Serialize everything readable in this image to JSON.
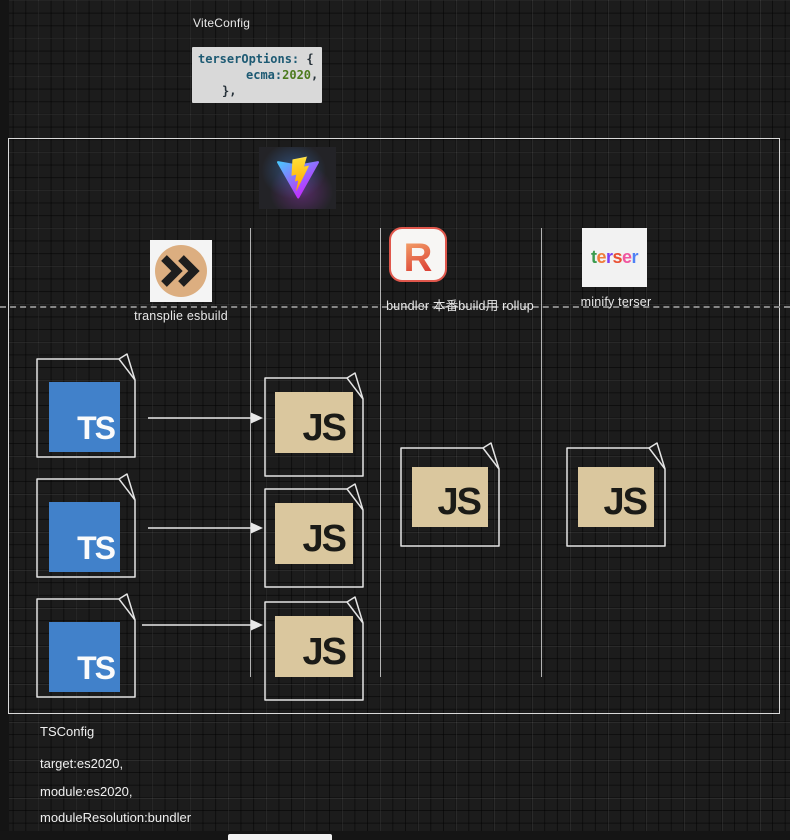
{
  "header": {
    "vite_config_label": "ViteConfig",
    "code": {
      "l1_key": "terserOptions:",
      "l1_punct": " {",
      "l2_key": "ecma:",
      "l2_value": "2020",
      "l2_punct": ",",
      "l3_punct": "},",
      "bg_color": "#d9d9d9",
      "key_color": "#1d5a73",
      "value_color": "#4c7a1d",
      "punct_color": "#27323a"
    }
  },
  "diagram": {
    "vite_icon": {
      "name": "vite-logo",
      "v_from": "#41D1FF",
      "v_to": "#BD34FE",
      "bolt_from": "#FFEA83",
      "bolt_mid": "#FFDD35",
      "bolt_to": "#FFA800"
    },
    "stages": {
      "esbuild": {
        "label": "transplie esbuild",
        "circle_color": "#dcae80",
        "chevron_color": "#1e1e1e"
      },
      "rollup": {
        "label": "bundler 本番build用 rollup",
        "letter": "R",
        "border_color": "#e0574c",
        "gradient_from": "#f7b071",
        "gradient_to": "#da3b32"
      },
      "terser": {
        "label": "minify terser",
        "letters": [
          {
            "ch": "t",
            "color": "#3b9b4e"
          },
          {
            "ch": "e",
            "color": "#f07c3a"
          },
          {
            "ch": "r",
            "color": "#7b3ff2"
          },
          {
            "ch": "s",
            "color": "#ea4f33"
          },
          {
            "ch": "e",
            "color": "#f0569f"
          },
          {
            "ch": "r",
            "color": "#4f81f5"
          }
        ]
      }
    },
    "files": {
      "ts_label": "TS",
      "ts_bg": "#4181ca",
      "ts_text": "#fbfbfb",
      "js_label": "JS",
      "js_bg": "#dac79e",
      "js_text": "#1b1b17"
    }
  },
  "footer": {
    "title": "TSConfig",
    "lines": [
      "target:es2020,",
      "module:es2020,",
      "moduleResolution:bundler"
    ]
  }
}
